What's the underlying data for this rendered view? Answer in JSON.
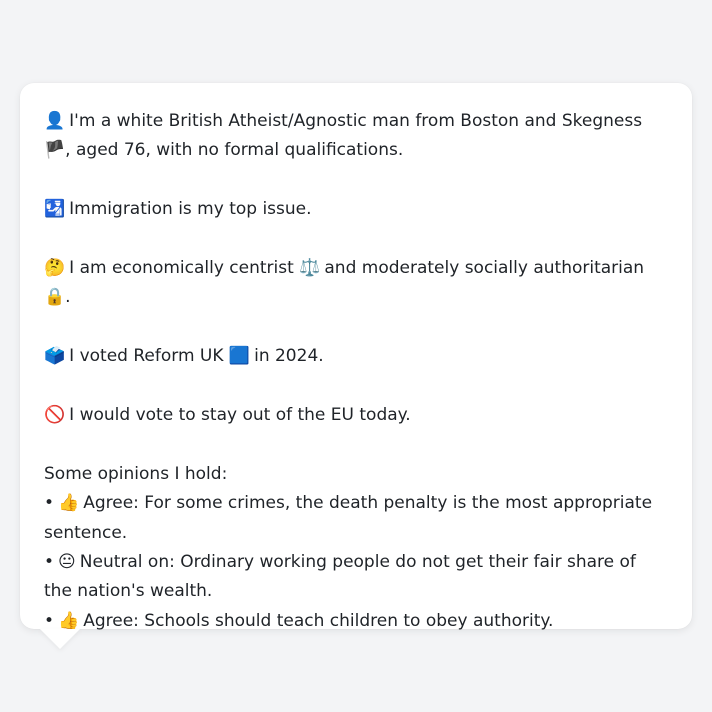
{
  "profile": {
    "intro_emoji": "👤",
    "intro_text": "I'm a white British Atheist/Agnostic man from Boston and Skegness",
    "intro_flag": "🏴",
    "intro_tail": ", aged 76, with no formal qualifications.",
    "issue_emoji": "🛂",
    "issue_text": "Immigration is my top issue.",
    "stance_emoji": "🤔",
    "stance_text_a": "I am economically centrist",
    "stance_icon_a": "⚖️",
    "stance_text_b": "and moderately socially authoritarian",
    "stance_icon_b": "🔒",
    "stance_tail": ".",
    "vote_emoji": "🗳️",
    "vote_text_a": "I voted Reform UK",
    "vote_icon": "🟦",
    "vote_text_b": "in 2024.",
    "eu_emoji": "🚫",
    "eu_text": "I would vote to stay out of the EU today."
  },
  "opinions": {
    "heading": "Some opinions I hold:",
    "bullet": "•",
    "items": [
      {
        "emoji": "👍",
        "text": "Agree: For some crimes, the death penalty is the most appropriate sentence."
      },
      {
        "emoji": "😐",
        "text": "Neutral on: Ordinary working people do not get their fair share of the nation's wealth."
      },
      {
        "emoji": "👍",
        "text": "Agree: Schools should teach children to obey authority."
      }
    ]
  }
}
